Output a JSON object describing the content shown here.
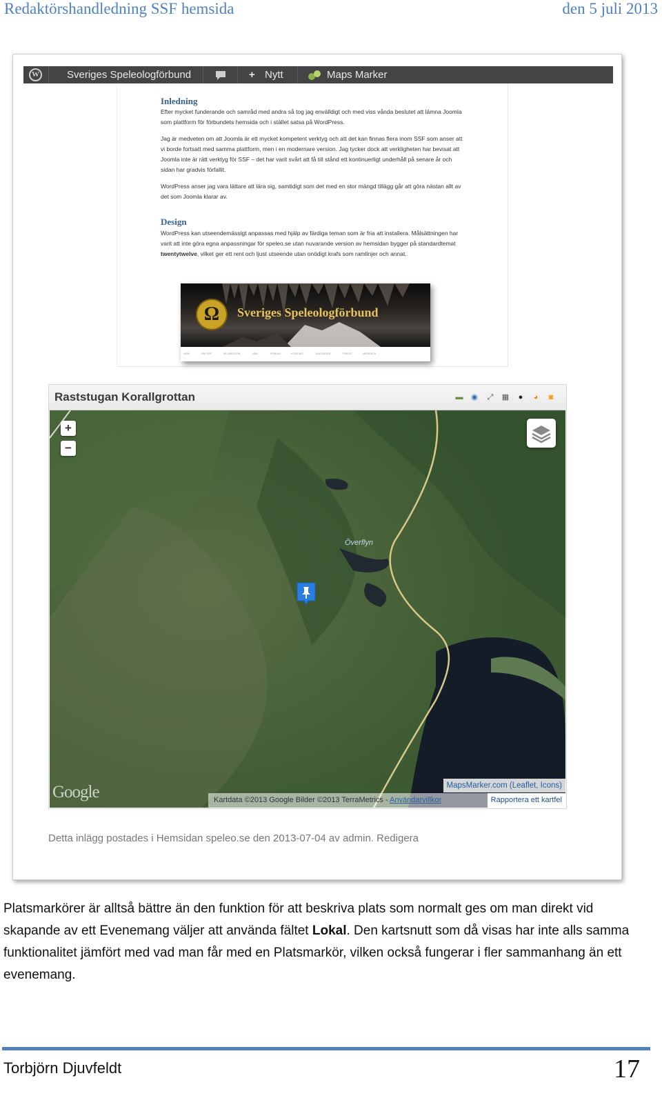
{
  "header": {
    "doc_title": "Redaktörshandledning SSF hemsida",
    "date": "den 5 juli 2013"
  },
  "admin_bar": {
    "site_name": "Sveriges Speleologförbund",
    "new_label": "Nytt",
    "plugin_label": "Maps Marker"
  },
  "article": {
    "heading_intro": "Inledning",
    "para1": "Efter mycket funderande och samråd med andra så tog jag envälldigt och med viss vånda beslutet att lämna Joomla som plattform för förbundets hemsida och i stället satsa på WordPress.",
    "para2": "Jag är medveten om att Joomla är ett mycket kompetent verktyg och att det kan finnas flera inom SSF som anser att vi borde fortsatt med samma plattform, men i en modernare version. Jag tycker dock att verkligheten har bevisat att Joomla inte är rätt verktyg för SSF – det har varit svårt att få till stånd ett kontinuerligt underhåll på senare år och sidan har gradvis förfallit.",
    "para3": "WordPress anser jag vara lättare att lära sig, samtidigt som det med en stor mängd tillägg går att göra nästan allt av det som Joomla klarar av.",
    "heading_design": "Design",
    "para4_a": "WordPress kan utseendemässigt anpassas med hjälp av färdiga teman som är fria att installera. Målsättningen har varit att inte göra egna anpassningar för speleo.se utan nuvarande version av hemsidan bygger på standardtemat ",
    "para4_bold": "twentytwelve",
    "para4_b": ", vilket ger ett rent och ljust utseende utan onödigt krafs som ramlinjer och annat.",
    "banner_title": "Sveriges Speleologförbund",
    "banner_nav": [
      "HEM",
      "OM SSF",
      "BLI MEDLEM",
      "VAD",
      "FORUM",
      "KONTAKT",
      "KALENDER",
      "PRESS",
      "MEDDELA"
    ]
  },
  "map": {
    "title": "Raststugan Korallgrottan",
    "place_label": "Överflyn",
    "zoom_in": "+",
    "zoom_out": "−",
    "google_logo": "Google",
    "credits": "MapsMarker.com (Leaflet, Icons)",
    "attribution": "Kartdata ©2013 Google Bilder ©2013 TerraMetrics - ",
    "terms": "Användarvillkor",
    "report": "Rapportera ett kartfel",
    "toolbar_icons": [
      "car-icon",
      "globe-icon",
      "fullscreen-icon",
      "qr-code-icon",
      "wheel-icon",
      "chrome-icon",
      "rss-icon"
    ]
  },
  "post_meta": "Detta inlägg postades i Hemsidan speleo.se den 2013-07-04 av admin. Redigera",
  "body": {
    "text_a": "Platsmarkörer är alltså bättre än den funktion för att beskriva plats som normalt ges om man direkt vid skapande av ett Evenemang väljer att använda fältet ",
    "text_bold": "Lokal",
    "text_b": ". Den kartsnutt som då visas har inte alls samma funktionalitet jämfört med vad man får med en Platsmarkör, vilken också fungerar i fler sammanhang än ett evenemang."
  },
  "footer": {
    "author": "Torbjörn Djuvfeldt",
    "page_number": "17"
  }
}
